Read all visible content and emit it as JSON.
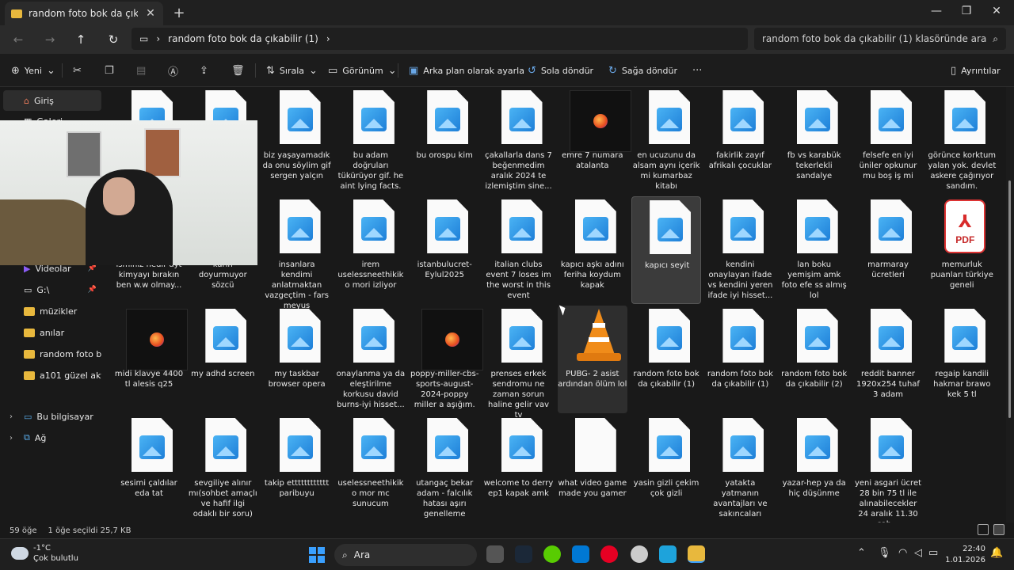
{
  "window": {
    "tab_title": "random foto bok da çıkabilir (",
    "tab_close": "✕",
    "new_tab": "+",
    "minimize": "—",
    "maximize": "❐",
    "close": "✕"
  },
  "address": {
    "path": "random foto bok da çıkabilir (1)",
    "search_placeholder": "random foto bok da çıkabilir (1) klasöründe ara"
  },
  "toolbar": {
    "new_label": "Yeni",
    "sort_label": "Sırala",
    "view_label": "Görünüm",
    "set_background_label": "Arka plan olarak ayarla",
    "rotate_left_label": "Sola döndür",
    "rotate_right_label": "Sağa döndür",
    "more_label": "···",
    "details_label": "Ayrıntılar"
  },
  "sidebar": {
    "items": [
      {
        "label": "Giriş"
      },
      {
        "label": "Galeri"
      },
      {
        "label": "Videolar"
      },
      {
        "label": "G:\\"
      },
      {
        "label": "müzikler"
      },
      {
        "label": "anılar"
      },
      {
        "label": "random foto bok d"
      },
      {
        "label": "a101 güzel aktüel"
      },
      {
        "label": "Bu bilgisayar"
      },
      {
        "label": "Ağ"
      }
    ]
  },
  "files": [
    {
      "label": "",
      "kind": "image"
    },
    {
      "label": "",
      "kind": "image"
    },
    {
      "label": "biz yaşayamadık da onu söylim gif sergen yalçın",
      "kind": "image"
    },
    {
      "label": "bu adam doğruları tükürüyor gif. he aint lying facts.",
      "kind": "image"
    },
    {
      "label": "bu orospu kim",
      "kind": "image"
    },
    {
      "label": "çakallarla dans 7 beğenmedim aralık 2024 te izlemiştim sine...",
      "kind": "image"
    },
    {
      "label": "emre 7 numara atalanta",
      "kind": "firefox"
    },
    {
      "label": "en ucuzunu da alsam aynı içerik mi kumarbaz kitabı",
      "kind": "image"
    },
    {
      "label": "fakirlik zayıf afrikalı çocuklar",
      "kind": "image"
    },
    {
      "label": "fb vs karabük tekerlekli sandalye",
      "kind": "image"
    },
    {
      "label": "felsefe en iyi üniler opkunur mu boş iş mi",
      "kind": "image"
    },
    {
      "label": "görünce korktum yalan yok. devlet askere çağırıyor sandım.",
      "kind": "image"
    },
    {
      "label": "isminiz nedir ayt kimyayı bırakın ben w.w olmay...",
      "kind": "image"
    },
    {
      "label": "karın doyurmuyor sözcü",
      "kind": "image"
    },
    {
      "label": "insanlara kendimi anlatmaktan vazgeçtim - fars meyus",
      "kind": "image"
    },
    {
      "label": "irem uselessneethikiko mori izliyor",
      "kind": "image"
    },
    {
      "label": "istanbulucret-Eylul2025",
      "kind": "image"
    },
    {
      "label": "italian clubs event 7 loses im the worst in this event",
      "kind": "image"
    },
    {
      "label": "kapıcı aşkı adını feriha koydum kapak",
      "kind": "image"
    },
    {
      "label": "kapıcı seyit",
      "kind": "image"
    },
    {
      "label": "kendini onaylayan ifade vs kendini yeren ifade iyi hisset...",
      "kind": "image"
    },
    {
      "label": "lan boku yemişim amk foto efe ss almış lol",
      "kind": "image"
    },
    {
      "label": "marmaray ücretleri",
      "kind": "image"
    },
    {
      "label": "memurluk puanları türkiye geneli",
      "kind": "pdf"
    },
    {
      "label": "midi klavye 4400 tl alesis q25",
      "kind": "firefox"
    },
    {
      "label": "my adhd screen",
      "kind": "image"
    },
    {
      "label": "my taskbar browser opera",
      "kind": "image"
    },
    {
      "label": "onaylanma ya da eleştirilme korkusu david burns-iyi hisset...",
      "kind": "image"
    },
    {
      "label": "poppy-miller-cbs-sports-august-2024-poppy miller a aşığım.",
      "kind": "firefox"
    },
    {
      "label": "prenses erkek sendromu ne zaman sorun haline gelir vav tv",
      "kind": "image"
    },
    {
      "label": "PUBG- 2 asist ardından ölüm lol",
      "kind": "vlc"
    },
    {
      "label": "random foto bok da çıkabilir (1)",
      "kind": "image"
    },
    {
      "label": "random foto bok da çıkabilir (1)",
      "kind": "image"
    },
    {
      "label": "random foto bok da çıkabilir (2)",
      "kind": "image"
    },
    {
      "label": "reddit banner 1920x254 tuhaf 3 adam",
      "kind": "image"
    },
    {
      "label": "regaip kandili hakmar brawo kek 5 tl",
      "kind": "image"
    },
    {
      "label": "sesimi çaldılar eda tat",
      "kind": "image"
    },
    {
      "label": "sevgiliye alınır mı(sohbet amaçlı ve hafif ilgi odaklı bir soru)",
      "kind": "image"
    },
    {
      "label": "takip etttttttttttt paribuyu",
      "kind": "image"
    },
    {
      "label": "uselessneethikiko mor mc sunucum",
      "kind": "image"
    },
    {
      "label": "utangaç bekar adam - falcılık hatası aşırı genelleme",
      "kind": "image"
    },
    {
      "label": "welcome to derry ep1 kapak amk",
      "kind": "image"
    },
    {
      "label": "what video game made you gamer",
      "kind": "blank"
    },
    {
      "label": "yasin gizli çekim çok gizli",
      "kind": "image"
    },
    {
      "label": "yatakta yatmanın avantajları ve sakıncaları",
      "kind": "image"
    },
    {
      "label": "yazar-hep ya da hiç düşünme",
      "kind": "image"
    },
    {
      "label": "yeni asgari ücret 28 bin 75 tl ile alınabilecekler 24 aralık 11.30 sab...",
      "kind": "image"
    }
  ],
  "pdf": {
    "mark": "⅄",
    "text": "PDF"
  },
  "status": {
    "count": "59 öğe",
    "selection": "1 öğe seçildi  25,7 KB"
  },
  "taskbar": {
    "temperature": "-1°C",
    "weather": "Çok bulutlu",
    "search_label": "Ara",
    "time": "22:40",
    "date": "1.01.2026"
  },
  "colors": {
    "accent": "#3aa0ff",
    "folder": "#e8b83d",
    "selected": "#3b3b3b"
  }
}
